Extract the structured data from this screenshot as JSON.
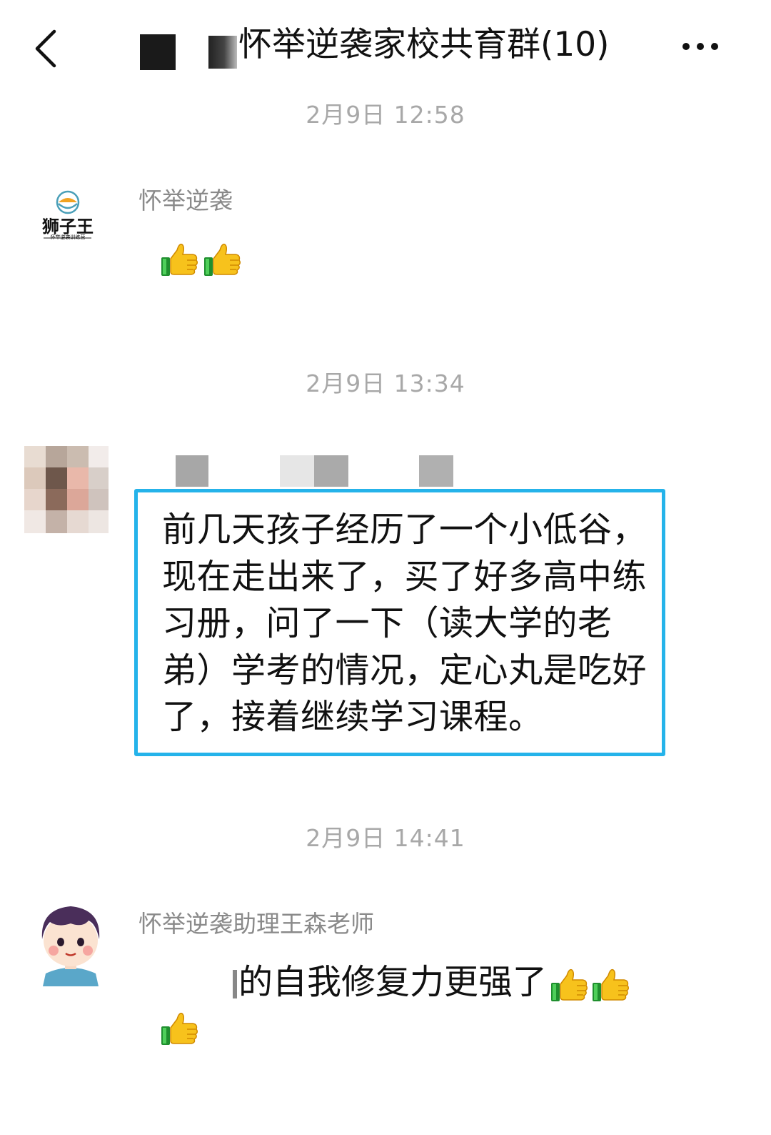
{
  "header": {
    "title": "怀举逆袭家校共育群(10)",
    "back_icon": "chevron-left-icon",
    "more_icon": "more-dots-icon"
  },
  "messages": [
    {
      "timestamp": "2月9日 12:58",
      "sender": "怀举逆袭",
      "avatar_text": "狮子王",
      "avatar_subtext": "怀举逆袭训练营",
      "content_icons": [
        "thumbs-up-icon",
        "thumbs-up-icon"
      ]
    },
    {
      "timestamp": "2月9日 13:34",
      "sender": "",
      "content": "前几天孩子经历了一个小低谷，现在走出来了，买了好多高中练习册，问了一下（读大学的老弟）学考的情况，定心丸是吃好了，接着继续学习课程。",
      "highlight_color": "#25b3ea"
    },
    {
      "timestamp": "2月9日 14:41",
      "sender": "怀举逆袭助理王森老师",
      "content": "的自我修复力更强了",
      "content_icons": [
        "thumbs-up-icon",
        "thumbs-up-icon",
        "thumbs-up-icon"
      ]
    }
  ],
  "colors": {
    "timestamp": "#a8a8a8",
    "sender": "#8a8a8a",
    "highlight_border": "#25b3ea"
  }
}
